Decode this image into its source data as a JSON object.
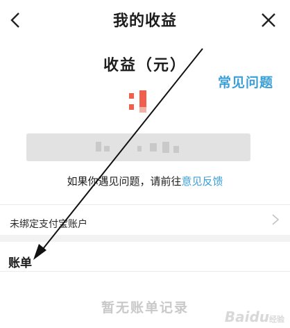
{
  "nav": {
    "title": "我的收益"
  },
  "earnings": {
    "label": "收益（元）"
  },
  "faq": {
    "label": "常见问题"
  },
  "feedback": {
    "prefix": "如果你遇见问题，请前往",
    "link": "意见反馈"
  },
  "alipay": {
    "label": "未绑定支付宝账户"
  },
  "bill": {
    "title": "账单",
    "empty": "暂无账单记录"
  },
  "watermark": {
    "main": "Baidu",
    "sub": "经验"
  },
  "icons": {
    "back": "chevron-left-icon",
    "close": "close-icon",
    "row": "chevron-right-icon"
  },
  "colors": {
    "link": "#3a9fd6",
    "amount": "#ef5f4b",
    "annotation": "#111111"
  }
}
